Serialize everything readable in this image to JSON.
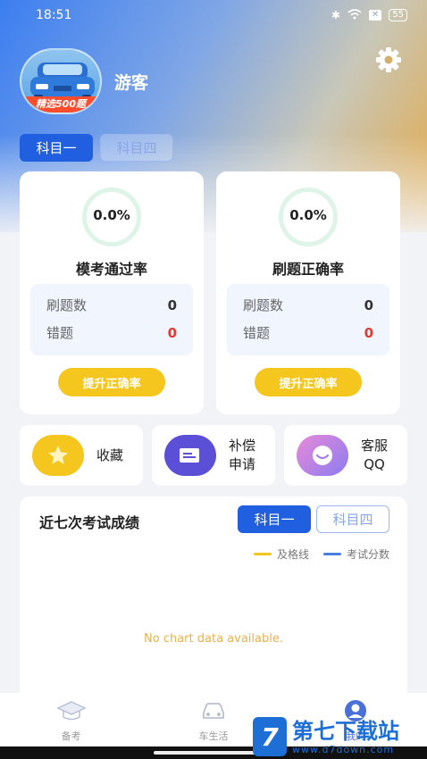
{
  "status_bar": {
    "time": "18:51",
    "battery": "55"
  },
  "profile": {
    "username": "游客",
    "avatar_banner": "精选500题"
  },
  "subject_tabs": [
    {
      "label": "科目一",
      "active": true
    },
    {
      "label": "科目四",
      "active": false
    }
  ],
  "cards": [
    {
      "percent": "0.0%",
      "title": "模考通过率",
      "rows": [
        {
          "label": "刷题数",
          "value": "0"
        },
        {
          "label": "错题",
          "value": "0"
        }
      ],
      "button": "提升正确率"
    },
    {
      "percent": "0.0%",
      "title": "刷题正确率",
      "rows": [
        {
          "label": "刷题数",
          "value": "0"
        },
        {
          "label": "错题",
          "value": "0"
        }
      ],
      "button": "提升正确率"
    }
  ],
  "actions": [
    {
      "label": "收藏",
      "icon": "star-icon"
    },
    {
      "label_line1": "补偿",
      "label_line2": "申请",
      "icon": "form-icon"
    },
    {
      "label_line1": "客服",
      "label_line2": "QQ",
      "icon": "smile-icon"
    }
  ],
  "scores": {
    "title": "近七次考试成绩",
    "tabs": [
      {
        "label": "科目一",
        "active": true
      },
      {
        "label": "科目四",
        "active": false
      }
    ],
    "legend": [
      {
        "label": "及格线",
        "color": "#f5c61d"
      },
      {
        "label": "考试分数",
        "color": "#4a7de0"
      }
    ],
    "empty_message": "No chart data available."
  },
  "tab_bar": [
    {
      "label": "备考",
      "icon": "graduation-cap-icon"
    },
    {
      "label": "车生活",
      "icon": "car-icon"
    },
    {
      "label": "我的",
      "icon": "user-icon",
      "active": true
    }
  ],
  "watermark": {
    "title": "第七下载站",
    "url": "www.d7down.com"
  },
  "colors": {
    "primary": "#1f5fe0",
    "accent": "#f5c61d",
    "error": "#e23b2e"
  }
}
